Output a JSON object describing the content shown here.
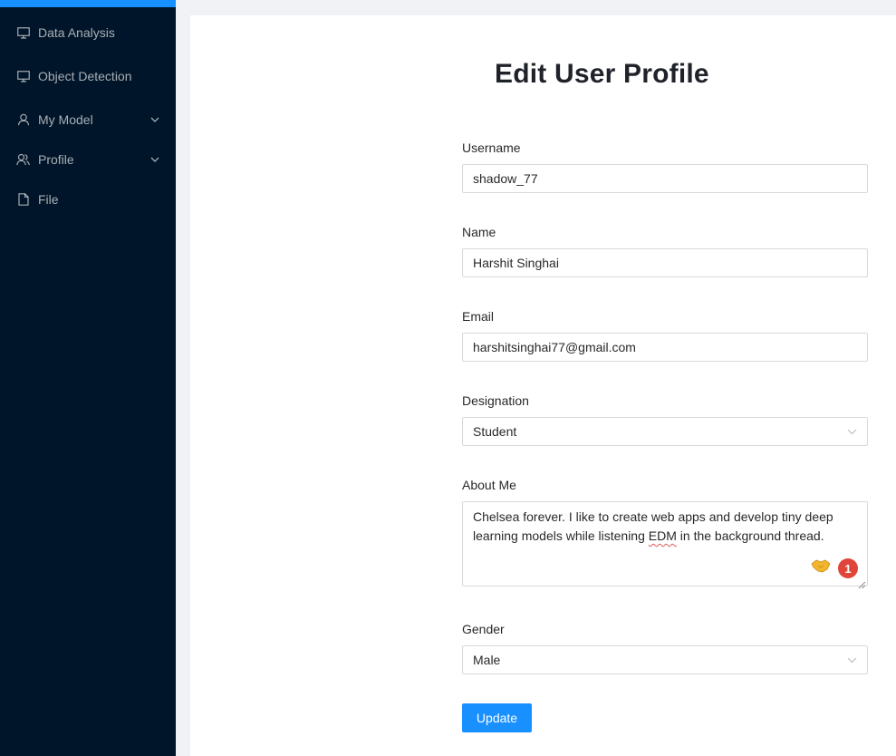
{
  "sidebar": {
    "items": [
      {
        "label": "Data Analysis",
        "icon": "desktop-icon"
      },
      {
        "label": "Object Detection",
        "icon": "desktop-icon"
      },
      {
        "label": "My Model",
        "icon": "user-icon",
        "expandable": true
      },
      {
        "label": "Profile",
        "icon": "team-icon",
        "expandable": true
      },
      {
        "label": "File",
        "icon": "file-icon"
      }
    ]
  },
  "form": {
    "title": "Edit User Profile",
    "username_label": "Username",
    "username_value": "shadow_77",
    "name_label": "Name",
    "name_value": "Harshit Singhai",
    "email_label": "Email",
    "email_value": "harshitsinghai77@gmail.com",
    "designation_label": "Designation",
    "designation_value": "Student",
    "about_label": "About Me",
    "about_text_before": "Chelsea forever. I like to create web apps and develop tiny deep learning models while listening ",
    "about_text_misspelled": "EDM",
    "about_text_after": " in the background thread.",
    "about_badge_count": "1",
    "gender_label": "Gender",
    "gender_value": "Male",
    "update_label": "Update"
  },
  "colors": {
    "sidebar_bg": "#001529",
    "accent": "#1890ff",
    "badge": "#e0453a"
  }
}
